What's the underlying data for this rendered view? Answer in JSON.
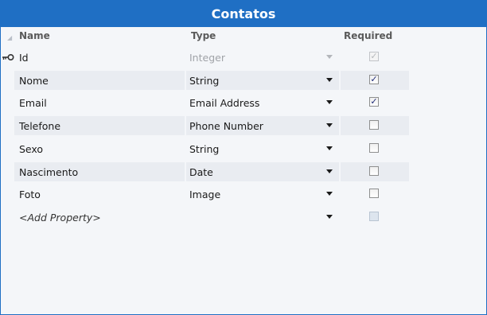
{
  "window": {
    "title": "Contatos"
  },
  "columns": {
    "name": "Name",
    "type": "Type",
    "required": "Required"
  },
  "rows": [
    {
      "name": "Id",
      "type": "Integer",
      "required": true,
      "key": true,
      "editable": false
    },
    {
      "name": "Nome",
      "type": "String",
      "required": true,
      "key": false,
      "editable": true
    },
    {
      "name": "Email",
      "type": "Email Address",
      "required": true,
      "key": false,
      "editable": true
    },
    {
      "name": "Telefone",
      "type": "Phone Number",
      "required": false,
      "key": false,
      "editable": true
    },
    {
      "name": "Sexo",
      "type": "String",
      "required": false,
      "key": false,
      "editable": true
    },
    {
      "name": "Nascimento",
      "type": "Date",
      "required": false,
      "key": false,
      "editable": true
    },
    {
      "name": "Foto",
      "type": "Image",
      "required": false,
      "key": false,
      "editable": true
    }
  ],
  "add_row": {
    "name": "<Add Property>",
    "type": ""
  },
  "icons": {
    "key": "key-icon",
    "dropdown": "chevron-down-icon",
    "check": "checkmark-icon"
  },
  "colors": {
    "title_bar": "#1f6fc4",
    "title_text": "#ffffff",
    "row_alt": "#e9ecf1"
  }
}
